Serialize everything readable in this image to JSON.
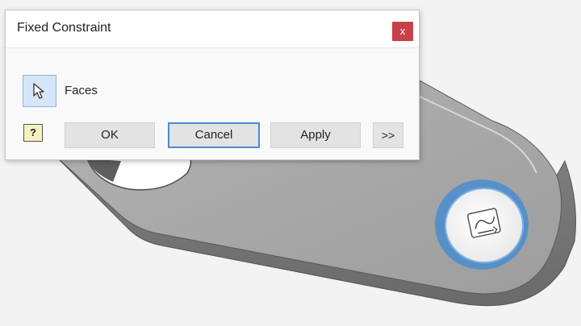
{
  "dialog": {
    "title": "Fixed Constraint",
    "close_label": "x",
    "selector_label": "Faces",
    "help_label": "?",
    "buttons": {
      "ok": "OK",
      "cancel": "Cancel",
      "apply": "Apply",
      "more": ">>"
    }
  },
  "icons": {
    "selector": "cursor-arrow-icon",
    "help": "help-icon",
    "close": "close-icon",
    "constraint_glyph": "fixed-constraint-icon"
  },
  "colors": {
    "close_button": "#c8404a",
    "selection_highlight": "#4a8dd0",
    "selector_active": "#d4e6f7",
    "part_body": "#a9a9a9"
  }
}
